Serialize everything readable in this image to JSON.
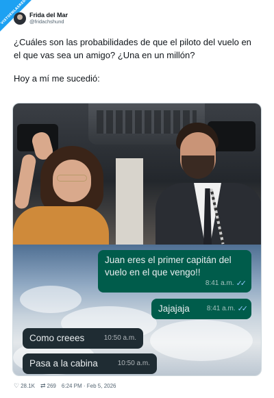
{
  "watermark": {
    "text": "VISTOENLASREDES"
  },
  "tweet": {
    "author": {
      "display_name": "Frida del Mar",
      "handle": "@fridachshund"
    },
    "paragraphs": [
      "¿Cuáles son las probabilidades de que el piloto del vuelo en el que vas sea un amigo? ¿Una en un millón?",
      "Hoy a mí me sucedió:"
    ],
    "chat": {
      "messages": [
        {
          "direction": "out",
          "text": "Juan eres el primer capitán del vuelo en el que vengo!!",
          "time": "8:41 a.m.",
          "status_icon": "double-check-icon"
        },
        {
          "direction": "out",
          "text": "Jajajaja",
          "time": "8:41 a.m.",
          "status_icon": "double-check-icon"
        },
        {
          "direction": "in",
          "text": "Como creees",
          "time": "10:50 a.m."
        },
        {
          "direction": "in",
          "text": "Pasa a la cabina",
          "time": "10:50 a.m."
        }
      ],
      "colors": {
        "outgoing": "#005c4b",
        "incoming": "#1f2c33",
        "ticks": "#8fc7ff"
      }
    },
    "stats": {
      "likes": "28.1K",
      "retweets": "269",
      "timestamp": "6:24 PM · Feb 5, 2026",
      "like_icon": "heart-icon",
      "retweet_icon": "retweet-icon"
    }
  }
}
